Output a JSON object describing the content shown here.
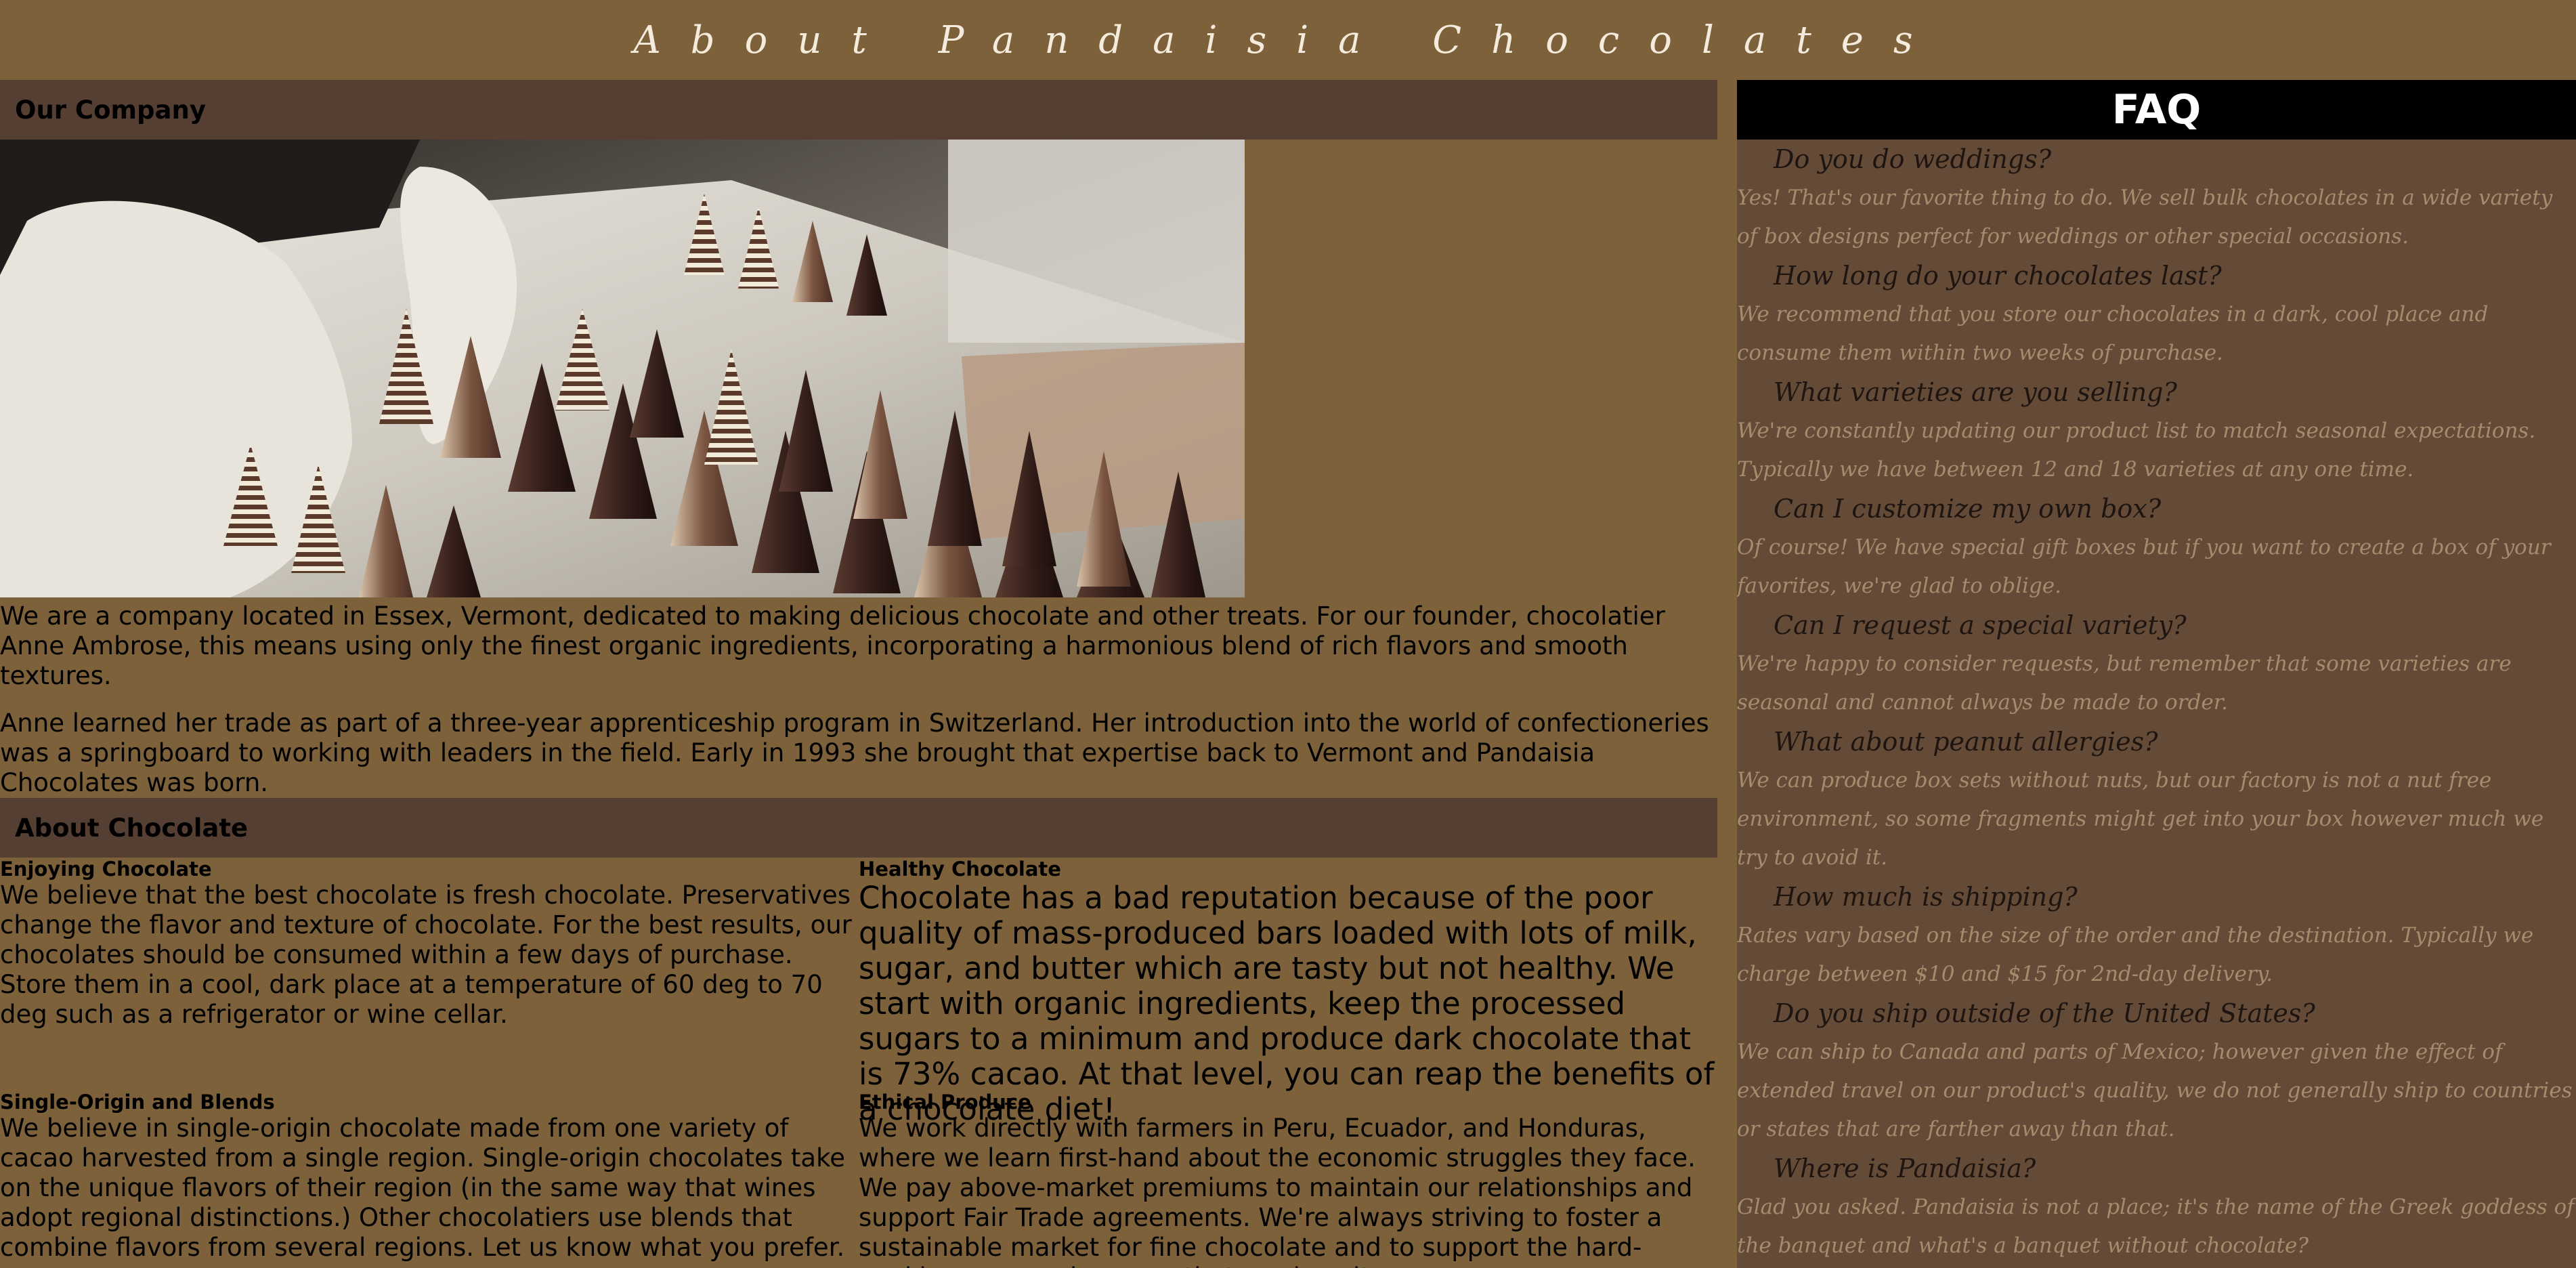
{
  "header": {
    "title": "About Pandaisia Chocolates"
  },
  "company": {
    "heading": "Our Company",
    "image_alt": "Hands in white gloves arranging chocolates on a tray",
    "paragraph1": "We are a company located in Essex, Vermont, dedicated to making delicious chocolate and other treats. For our founder, chocolatier Anne Ambrose, this means using only the finest organic ingredients, incorporating a harmonious blend of rich flavors and smooth textures.",
    "paragraph2": "Anne learned her trade as part of a three-year apprenticeship program in Switzerland. Her introduction into the world of confectioneries was a springboard to working with leaders in the field. Early in 1993 she brought that expertise back to Vermont and Pandaisia Chocolates was born."
  },
  "chocolate": {
    "heading": "About Chocolate",
    "enjoying": {
      "title": "Enjoying Chocolate",
      "text": "We believe that the best chocolate is fresh chocolate. Preservatives change the flavor and texture of chocolate. For the best results, our chocolates should be consumed within a few days of purchase. Store them in a cool, dark place at a temperature of 60 deg to 70 deg such as a refrigerator or wine cellar."
    },
    "healthy": {
      "title": "Healthy Chocolate",
      "text": "Chocolate has a bad reputation because of the poor quality of mass-produced bars loaded with lots of milk, sugar, and butter which are tasty but not healthy. We start with organic ingredients, keep the processed sugars to a minimum and produce dark chocolate that is 73% cacao. At that level, you can reap the benefits of a chocolate diet!"
    },
    "single_origin": {
      "title": "Single-Origin and Blends",
      "text": "We believe in single-origin chocolate made from one variety of cacao harvested from a single region. Single-origin chocolates take on the unique flavors of their region (in the same way that wines adopt regional distinctions.) Other chocolatiers use blends that combine flavors from several regions. Let us know what you prefer."
    },
    "ethical": {
      "title": "Ethical Produce",
      "text": "We work directly with farmers in Peru, Ecuador, and Honduras, where we learn first-hand about the economic struggles they face. We pay above-market premiums to maintain our relationships and support Fair Trade agreements. We're always striving to foster a sustainable market for fine chocolate and to support the hard-working men and women that produce it."
    }
  },
  "faq": {
    "heading": "FAQ",
    "items": [
      {
        "q": "Do you do weddings?",
        "a": "Yes! That's our favorite thing to do. We sell bulk chocolates in a wide variety of box designs perfect for weddings or other special occasions."
      },
      {
        "q": "How long do your chocolates last?",
        "a": "We recommend that you store our chocolates in a dark, cool place and consume them within two weeks of purchase."
      },
      {
        "q": "What varieties are you selling?",
        "a": "We're constantly updating our product list to match seasonal expectations. Typically we have between 12 and 18 varieties at any one time."
      },
      {
        "q": "Can I customize my own box?",
        "a": "Of course! We have special gift boxes but if you want to create a box of your favorites, we're glad to oblige."
      },
      {
        "q": "Can I request a special variety?",
        "a": "We're happy to consider requests, but remember that some varieties are seasonal and cannot always be made to order."
      },
      {
        "q": "What about peanut allergies?",
        "a": "We can produce box sets without nuts, but our factory is not a nut free environment, so some fragments might get into your box however much we try to avoid it."
      },
      {
        "q": "How much is shipping?",
        "a": "Rates vary based on the size of the order and the destination. Typically we charge between $10 and $15 for 2nd-day delivery."
      },
      {
        "q": "Do you ship outside of the United States?",
        "a": "We can ship to Canada and parts of Mexico; however given the effect of extended travel on our product's quality, we do not generally ship to countries or states that are farther away than that."
      },
      {
        "q": "Where is Pandaisia?",
        "a": "Glad you asked. Pandaisia is not a place; it's the name of the Greek goddess of the banquet and what's a banquet without chocolate?"
      }
    ]
  },
  "colors": {
    "page_background": "#7d613a",
    "section_bar": "#553f33",
    "faq_background": "#644b38",
    "faq_header": "#000000",
    "faq_question": "#1e1410",
    "faq_answer": "#a68b6c",
    "title_text": "#f4ebdc"
  }
}
